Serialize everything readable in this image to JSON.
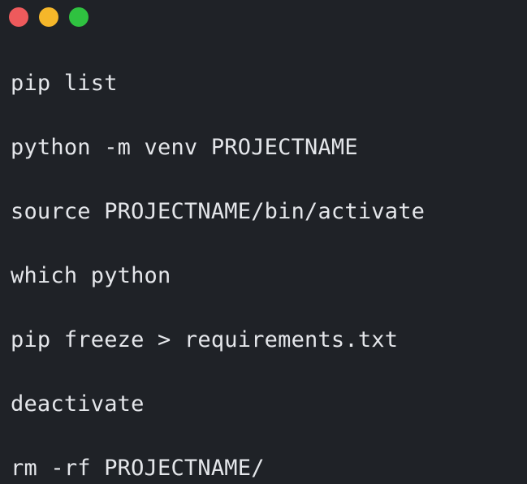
{
  "window": {
    "controls": [
      {
        "name": "close",
        "color": "#ee5a5c"
      },
      {
        "name": "minimize",
        "color": "#f5b72a"
      },
      {
        "name": "maximize",
        "color": "#2fc240"
      }
    ]
  },
  "code": {
    "lines": [
      "pip list",
      "python -m venv PROJECTNAME",
      "source PROJECTNAME/bin/activate",
      "which python",
      "pip freeze > requirements.txt",
      "deactivate",
      "rm -rf PROJECTNAME/"
    ]
  },
  "colors": {
    "background": "#1f2227",
    "text": "#e4e6ea"
  }
}
